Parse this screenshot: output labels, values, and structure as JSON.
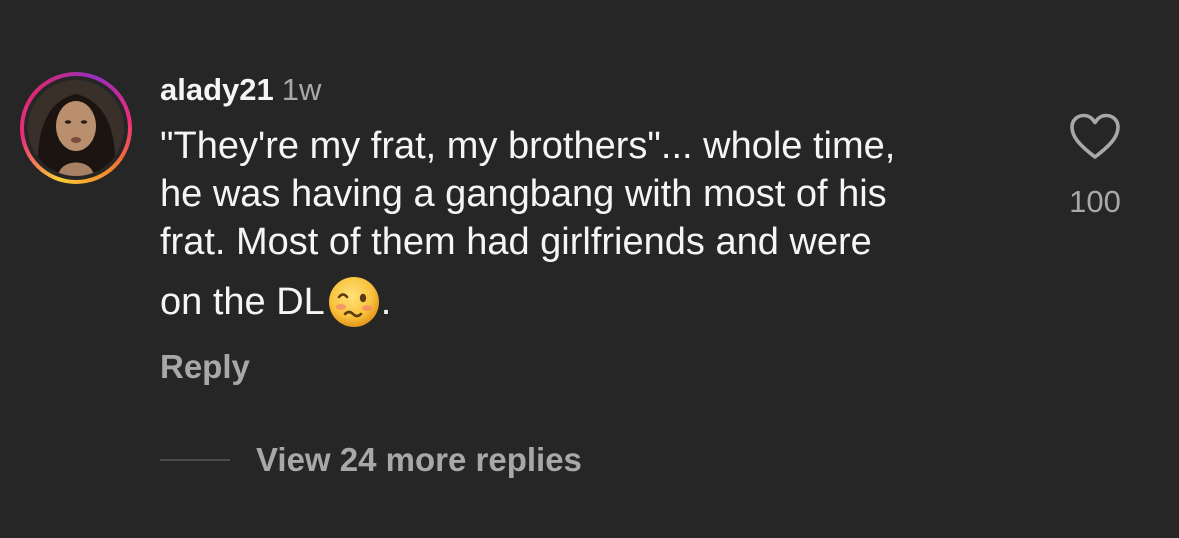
{
  "comment": {
    "username": "alady21",
    "time_ago": "1w",
    "text_lines": [
      "\"They're my frat, my brothers\"... whole time,",
      "he was having a gangbang with most of his",
      "frat. Most of them had girlfriends and were"
    ],
    "last_line_text": "on the DL",
    "last_line_suffix": ".",
    "emoji": "woozy-face-emoji",
    "reply_label": "Reply",
    "like_icon": "heart-outline-icon",
    "like_count": "100"
  },
  "replies": {
    "view_more_label": "View 24 more replies"
  },
  "colors": {
    "background": "#262626",
    "primary_text": "#f5f5f5",
    "secondary_text": "#a8a8a8",
    "story_ring": [
      "#f9ce34",
      "#ee2a7b",
      "#962fbf"
    ]
  }
}
